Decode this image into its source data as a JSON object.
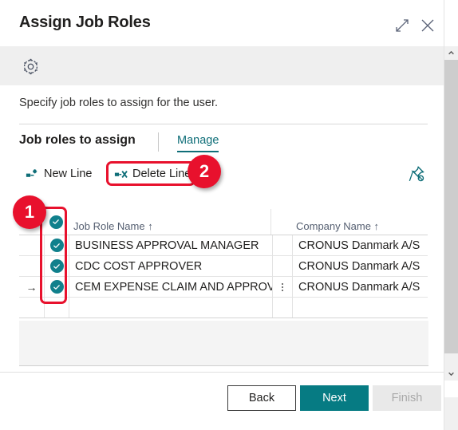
{
  "dialog": {
    "title": "Assign Job Roles",
    "expand_icon": "expand-diagonal-icon",
    "close_icon": "close-icon",
    "gear_icon": "gear-icon",
    "subtitle": "Specify job roles to assign for the user."
  },
  "section": {
    "title": "Job roles to assign",
    "tabs": [
      {
        "label": "Manage",
        "active": true
      }
    ]
  },
  "commandbar": {
    "new_line_label": "New Line",
    "delete_line_label": "Delete Line",
    "new_line_icon": "new-line-icon",
    "delete_line_icon": "delete-line-icon",
    "pin_icon": "pin-icon"
  },
  "grid": {
    "columns": [
      {
        "key": "indicator",
        "header": ""
      },
      {
        "key": "selected",
        "header": ""
      },
      {
        "key": "job_role_name",
        "header": "Job Role Name ↑"
      },
      {
        "key": "menu",
        "header": ""
      },
      {
        "key": "company_name",
        "header": "Company Name ↑"
      }
    ],
    "header_select_all_checked": true,
    "rows": [
      {
        "indicator": "",
        "selected": true,
        "job_role_name": "BUSINESS APPROVAL MANAGER",
        "menu": false,
        "company_name": "CRONUS Danmark A/S"
      },
      {
        "indicator": "",
        "selected": true,
        "job_role_name": "CDC COST APPROVER",
        "menu": false,
        "company_name": "CRONUS Danmark A/S"
      },
      {
        "indicator": "→",
        "selected": true,
        "job_role_name": "CEM EXPENSE CLAIM AND APPROVER",
        "menu": true,
        "company_name": "CRONUS Danmark A/S"
      },
      {
        "indicator": "",
        "selected": null,
        "job_role_name": "",
        "menu": false,
        "company_name": ""
      }
    ]
  },
  "footer": {
    "back_label": "Back",
    "next_label": "Next",
    "finish_label": "Finish",
    "finish_disabled": true
  },
  "scrollbar": {
    "up_icon": "chevron-up-icon",
    "down_icon": "chevron-down-icon"
  },
  "annotations": [
    {
      "id": "1",
      "label": "1",
      "target": "row-selection-checkbox-column"
    },
    {
      "id": "2",
      "label": "2",
      "target": "delete-line-button"
    }
  ],
  "colors": {
    "accent_teal": "#0f6e78",
    "button_teal": "#067b83",
    "check_teal": "#10808c",
    "annotation_red": "#e8112d",
    "gear_band": "#efefef"
  }
}
